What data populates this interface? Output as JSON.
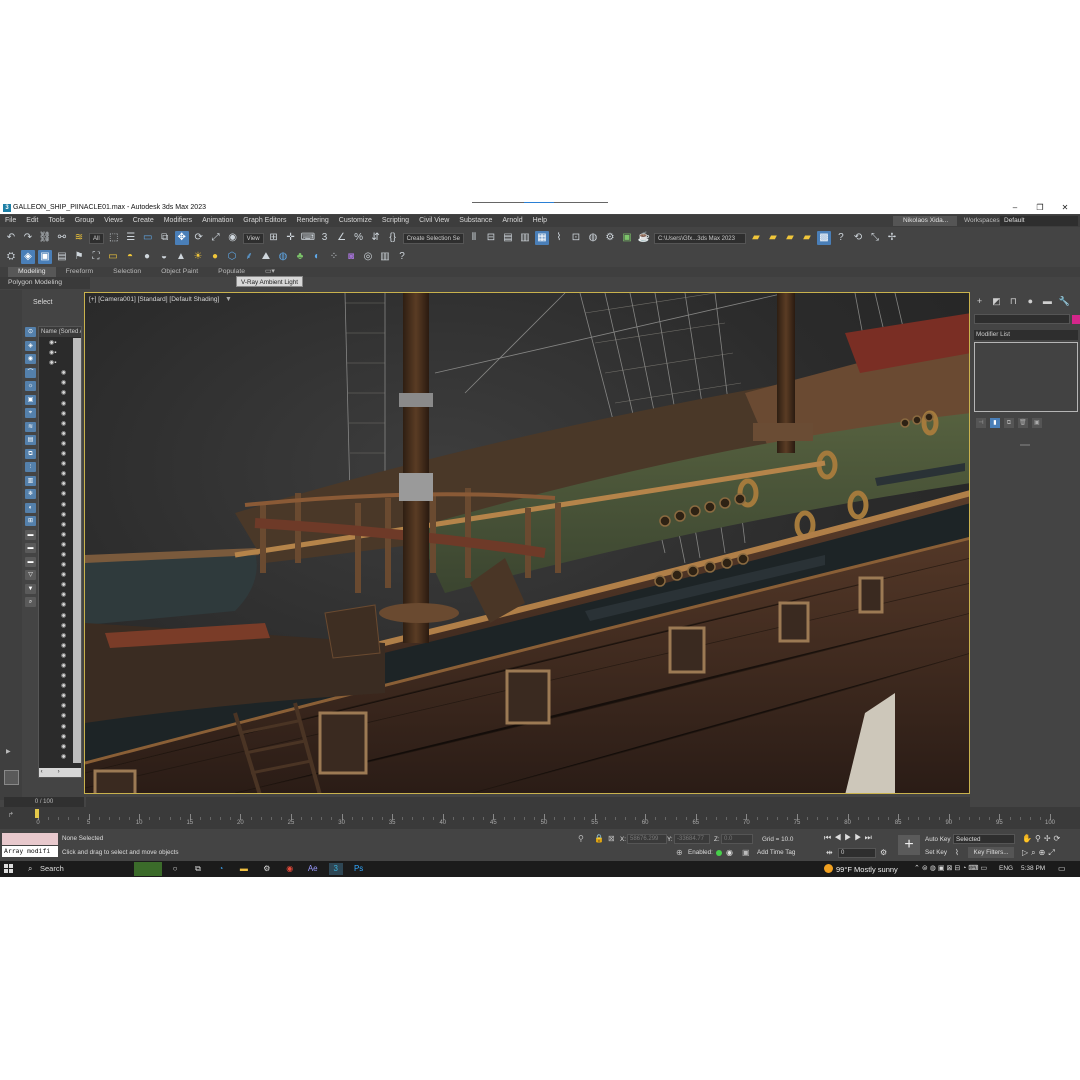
{
  "window": {
    "title": "GALLEON_SHIP_PIINACLE01.max - Autodesk 3ds Max 2023",
    "app_icon_letter": "3",
    "minimize": "–",
    "restore": "❐",
    "close": "✕"
  },
  "menubar": {
    "items": [
      "File",
      "Edit",
      "Tools",
      "Group",
      "Views",
      "Create",
      "Modifiers",
      "Animation",
      "Graph Editors",
      "Rendering",
      "Customize",
      "Scripting",
      "Civil View",
      "Substance",
      "Arnold",
      "Help"
    ],
    "user": "Nikolaos Xida...",
    "workspaces_label": "Workspaces:",
    "workspace": "Default"
  },
  "toolbar": {
    "filter_select": "All",
    "refcoord_select": "View",
    "named_selection": "Create Selection Se",
    "project_path": "C:\\Users\\Gfx...3ds Max 2023"
  },
  "ribbon": {
    "tabs": [
      "Modeling",
      "Freeform",
      "Selection",
      "Object Paint",
      "Populate"
    ],
    "active_tab": "Modeling",
    "panel_label": "Polygon Modeling",
    "tooltip": "V-Ray Ambient Light"
  },
  "scene_explorer": {
    "select_label": "Select",
    "column_header": "Name (Sorted A",
    "row_count": 42
  },
  "viewport": {
    "label": "[+] [Camera001] [Standard] [Default Shading]"
  },
  "command_panel": {
    "modifier_list": "Modifier List",
    "color": "#d4268a"
  },
  "timeline": {
    "frame_counter": "0 / 100",
    "ticks": [
      0,
      5,
      10,
      15,
      20,
      25,
      30,
      35,
      40,
      45,
      50,
      55,
      60,
      65,
      70,
      75,
      80,
      85,
      90,
      95,
      100
    ],
    "max_frame": 100
  },
  "status": {
    "maxscript_output": "Array modifi",
    "selection_info": "None Selected",
    "prompt": "Click and drag to select and move objects",
    "x_label": "X:",
    "x_value": "58676.299",
    "y_label": "Y:",
    "y_value": "-33684.77",
    "z_label": "Z:",
    "z_value": "0.0",
    "grid": "Grid = 10.0",
    "enabled": "Enabled:",
    "add_time_tag": "Add Time Tag",
    "auto_key": "Auto Key",
    "set_key": "Set Key",
    "selected": "Selected",
    "key_filters": "Key Filters...",
    "current_frame": "0"
  },
  "taskbar": {
    "search": "Search",
    "temperature": "99°F",
    "weather": "Mostly sunny",
    "language": "ENG",
    "time": "5:38 PM"
  }
}
